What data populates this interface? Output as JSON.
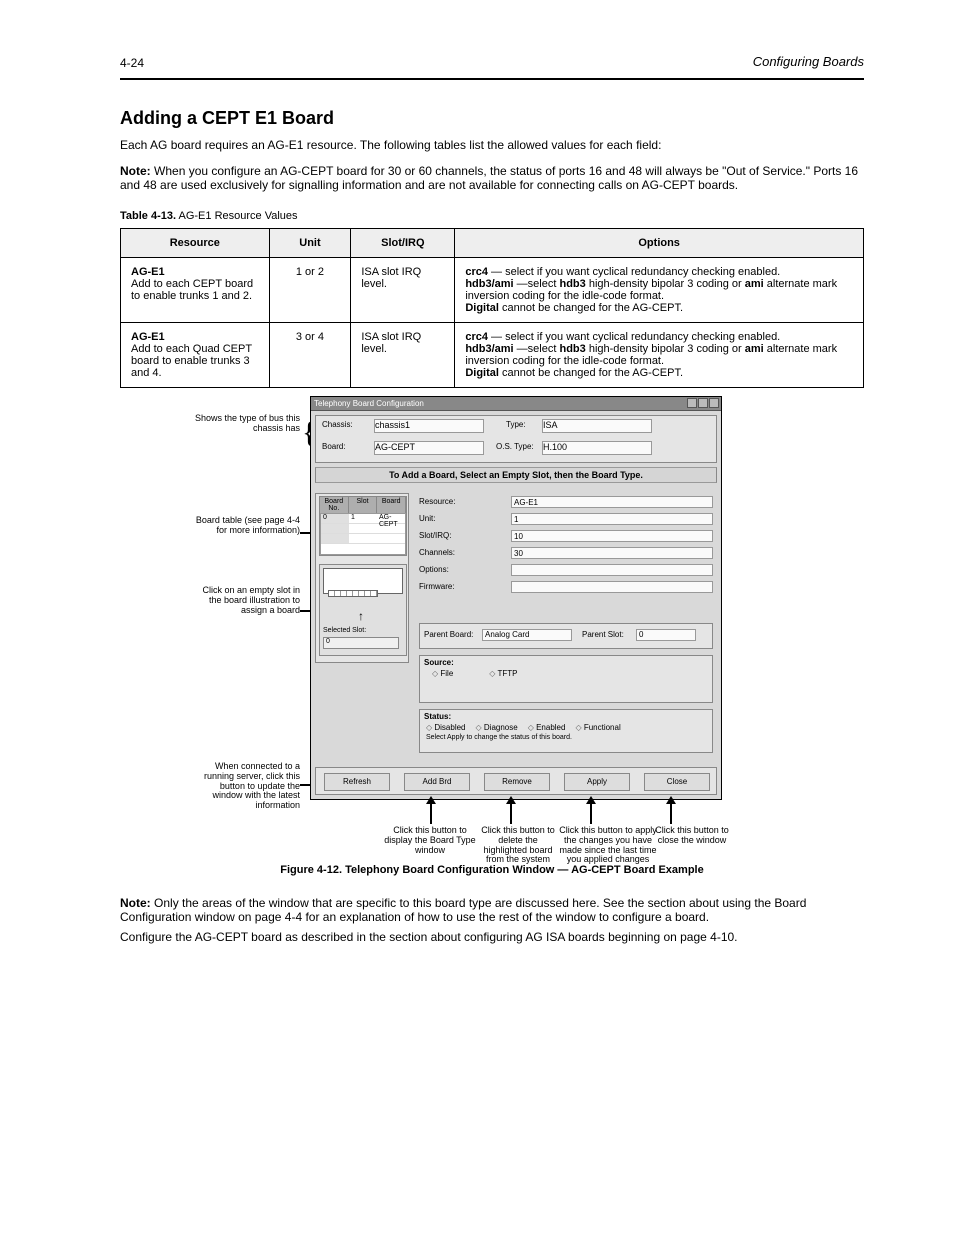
{
  "header": {
    "page_num": "4-24",
    "chapter": "Configuring Boards"
  },
  "section": {
    "title": "Adding a CEPT E1 Board",
    "body": "Each AG board requires an AG-E1 resource. The following tables list the allowed values for each field:",
    "note_label": "Note:",
    "note_text": "When you configure an AG-CEPT board for 30 or 60 channels, the status of ports 16 and 48 will always be \"Out of Service.\" Ports 16 and 48 are used exclusively for signalling information and are not available for connecting calls on AG-CEPT boards."
  },
  "table": {
    "caption_label": "Table 4-13.",
    "caption_text": "AG-E1 Resource Values",
    "headers": [
      "Resource",
      "Unit",
      "Slot/IRQ",
      "Options"
    ],
    "rows": [
      {
        "resource": "**AG-E1**\nAdd to each CEPT board to enable trunks 1 and 2.",
        "unit": "1 or 2",
        "slot": "ISA slot IRQ level.",
        "options": "**crc4** — select if you want cyclical redundancy checking enabled.\n**hdb3/ami** —select **hdb3** high-density bipolar 3 coding or **ami** alternate mark inversion coding for the idle-code format.\n**Digital** cannot be changed for the AG-CEPT."
      },
      {
        "resource": "**AG-E1**\nAdd to each Quad CEPT board to enable trunks 3 and 4.",
        "unit": "3 or 4",
        "slot": "ISA slot IRQ level.",
        "options": "**crc4** — select if you want cyclical redundancy checking enabled.\n**hdb3/ami** —select **hdb3** high-density bipolar 3 coding or **ami** alternate mark inversion coding for the idle-code format.\n**Digital** cannot be changed for the AG-CEPT."
      }
    ]
  },
  "figure": {
    "window_title": "Telephony Board Configuration",
    "info": {
      "chassis_label": "Chassis:",
      "chassis_value": "chassis1",
      "type_label": "Type:",
      "type_value": "ISA",
      "board_label": "Board:",
      "board_value": "AG-CEPT",
      "ostype_label": "O.S. Type:",
      "ostype_value": "H.100"
    },
    "text_bar": "To Add a Board, Select an Empty Slot, then the Board Type.",
    "brdtable": {
      "h1": "Board No.",
      "h2": "Slot",
      "h3": "Board",
      "r1a": "0",
      "r1b": "1",
      "r1c": "AG-CEPT"
    },
    "boardpic": {
      "sel_label": "Selected Slot:",
      "slot_value": "0"
    },
    "rfields": {
      "res": "Resource:",
      "res_v": "AG-E1",
      "unit": "Unit:",
      "unit_v": "1",
      "slot": "Slot/IRQ:",
      "slot_v": "10",
      "chan": "Channels:",
      "chan_v": "30",
      "opt": "Options:",
      "opt_v": "",
      "fw": "Firmware:",
      "fw_v": ""
    },
    "parent": {
      "lbl": "Parent Board:",
      "val": "Analog Card",
      "slot_lbl": "Parent Slot:",
      "slot_val": "0"
    },
    "src": {
      "title": "Source:",
      "r1": "File",
      "r2": "TFTP"
    },
    "status": {
      "title": "Status:",
      "r1": "Disabled",
      "r2": "Diagnose",
      "r3": "Enabled",
      "r4": "Functional",
      "msg": "Select Apply to change the status of this board."
    },
    "buttons": {
      "b1": "Refresh",
      "b2": "Add Brd",
      "b3": "Remove",
      "b4": "Apply",
      "b5": "Close"
    },
    "callouts": {
      "brace": "Shows the type of bus this chassis has",
      "table": "Board table (see page 4-4 for more information)",
      "board": "Click on an empty slot in the board illustration to assign a board",
      "refresh": "When connected to a running server, click this button to update the window with the latest information",
      "add": "Click this button to display the Board Type window",
      "remove": "Click this button to delete the highlighted board from the system",
      "apply": "Click this button to apply the changes you have made since the last time you applied changes",
      "close": "Click this button to close the window"
    },
    "caption_label": "Figure 4-12.",
    "caption_text": "Telephony Board Configuration Window — AG-CEPT Board Example"
  },
  "after_fig": {
    "note_label": "Note:",
    "note_text": "Only the areas of the window that are specific to this board type are discussed here. See the section about using the Board Configuration window on page 4-4 for an explanation of how to use the rest of the window to configure a board.",
    "p2": "Configure the AG-CEPT board as described in the section about configuring AG ISA boards beginning on page 4-10."
  }
}
